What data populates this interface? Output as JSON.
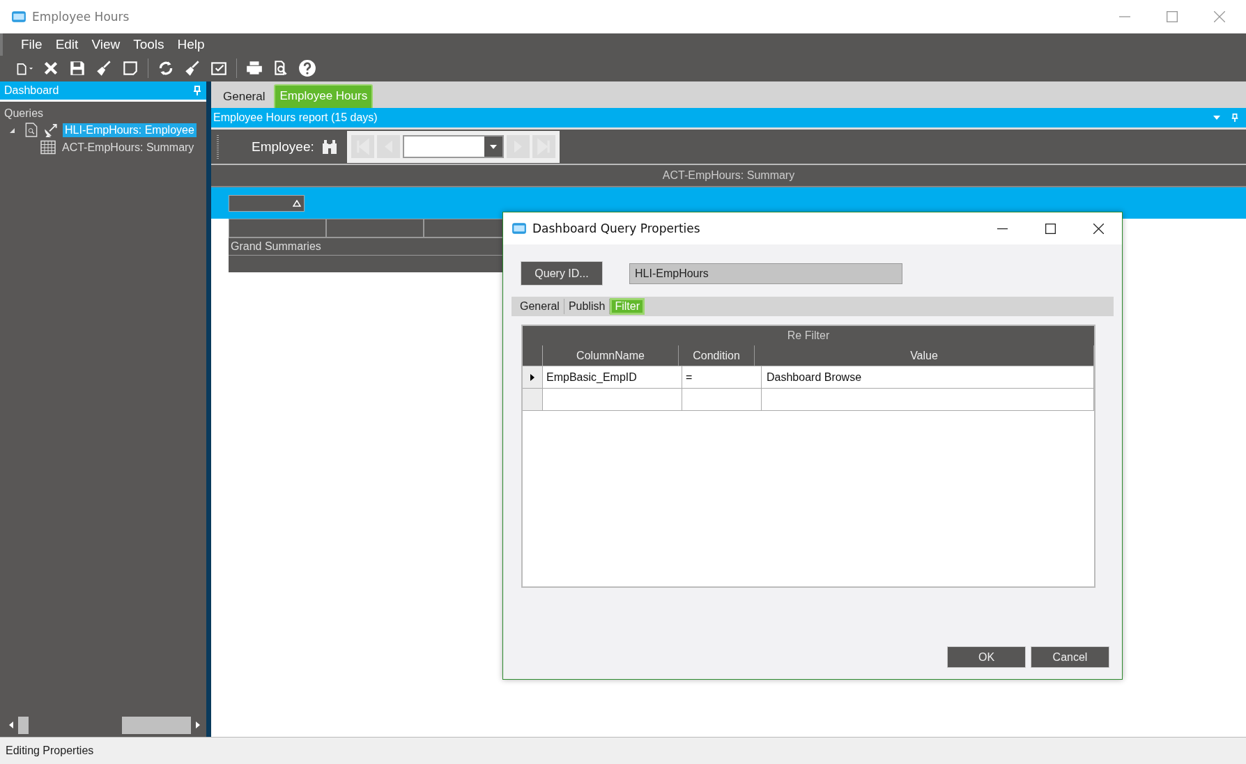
{
  "window": {
    "title": "Employee Hours"
  },
  "menu": [
    "File",
    "Edit",
    "View",
    "Tools",
    "Help"
  ],
  "sidebar": {
    "title": "Dashboard",
    "section": "Queries",
    "tree": [
      {
        "label": "HLI-EmpHours: Employee",
        "selected": true,
        "expanded": true,
        "children": [
          {
            "label": "ACT-EmpHours: Summary",
            "selected": false
          }
        ]
      }
    ]
  },
  "tabs": [
    {
      "label": "General",
      "selected": false
    },
    {
      "label": "Employee Hours",
      "selected": true
    }
  ],
  "report": {
    "title": "Employee Hours report (15 days)",
    "employee_label": "Employee:",
    "summary_title": "ACT-EmpHours: Summary",
    "grid_footer": "Grand Summaries"
  },
  "dialog": {
    "title": "Dashboard Query Properties",
    "query_button": "Query ID...",
    "query_value": "HLI-EmpHours",
    "tabs": [
      {
        "label": "General",
        "selected": false
      },
      {
        "label": "Publish",
        "selected": false
      },
      {
        "label": "Filter",
        "selected": true
      }
    ],
    "grid_title": "Re Filter",
    "columns": [
      "ColumnName",
      "Condition",
      "Value"
    ],
    "rows": [
      {
        "selected": true,
        "cells": [
          "EmpBasic_EmpID",
          "=",
          "Dashboard Browse"
        ]
      }
    ],
    "buttons": [
      "OK",
      "Cancel"
    ]
  },
  "status_bar": "Editing Properties"
}
